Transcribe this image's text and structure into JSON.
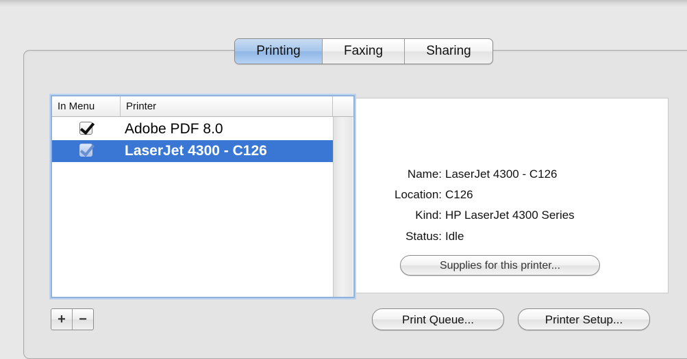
{
  "tabs": [
    {
      "label": "Printing",
      "selected": true
    },
    {
      "label": "Faxing",
      "selected": false
    },
    {
      "label": "Sharing",
      "selected": false
    }
  ],
  "printer_list": {
    "columns": [
      "In Menu",
      "Printer",
      ""
    ],
    "rows": [
      {
        "in_menu": true,
        "name": "Adobe PDF 8.0",
        "selected": false
      },
      {
        "in_menu": true,
        "name": "LaserJet 4300 - C126",
        "selected": true
      }
    ]
  },
  "info": {
    "name_label": "Name:",
    "name_value": "LaserJet 4300 - C126",
    "location_label": "Location:",
    "location_value": "C126",
    "kind_label": "Kind:",
    "kind_value": "HP LaserJet 4300 Series",
    "status_label": "Status:",
    "status_value": "Idle"
  },
  "buttons": {
    "supplies": "Supplies for this printer...",
    "print_queue": "Print Queue...",
    "printer_setup": "Printer Setup...",
    "add": "+",
    "remove": "−"
  },
  "colors": {
    "selection": "#3a77d5",
    "selected_tab": "#a6c6ec"
  }
}
